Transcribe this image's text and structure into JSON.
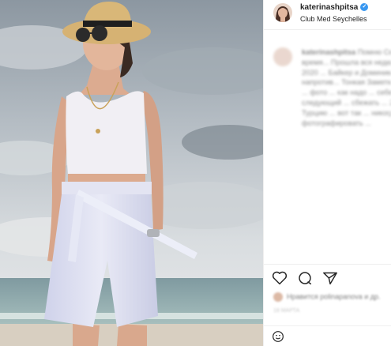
{
  "post": {
    "username": "katerinashpitsa",
    "location": "Club Med Seychelles",
    "verified": true,
    "caption_user": "katerinashpitsa",
    "caption_text": "Помню Сейшелы! Отличное время... Прошла вся неделя... Когда мы... 2020 ... Байкер и Доминика ... отпускаю ... напротив... Тонкая Заметка ... для себя ... Где ... фото ... как надо ... себе ... работы ... В следующий ... сбежать ... 2020 году ... в Турцию ... вот так ... никогда ... фотографировать ...",
    "likes_text": "Нравится polinapanova и др.",
    "date_text": "18 МАРТА"
  },
  "icons": [
    "verified-icon",
    "heart-icon",
    "comment-icon",
    "share-icon",
    "emoji-icon"
  ],
  "colors": {
    "verified": "#3897f0",
    "text": "#262626",
    "muted": "#8e8e8e",
    "divider": "#efefef"
  }
}
